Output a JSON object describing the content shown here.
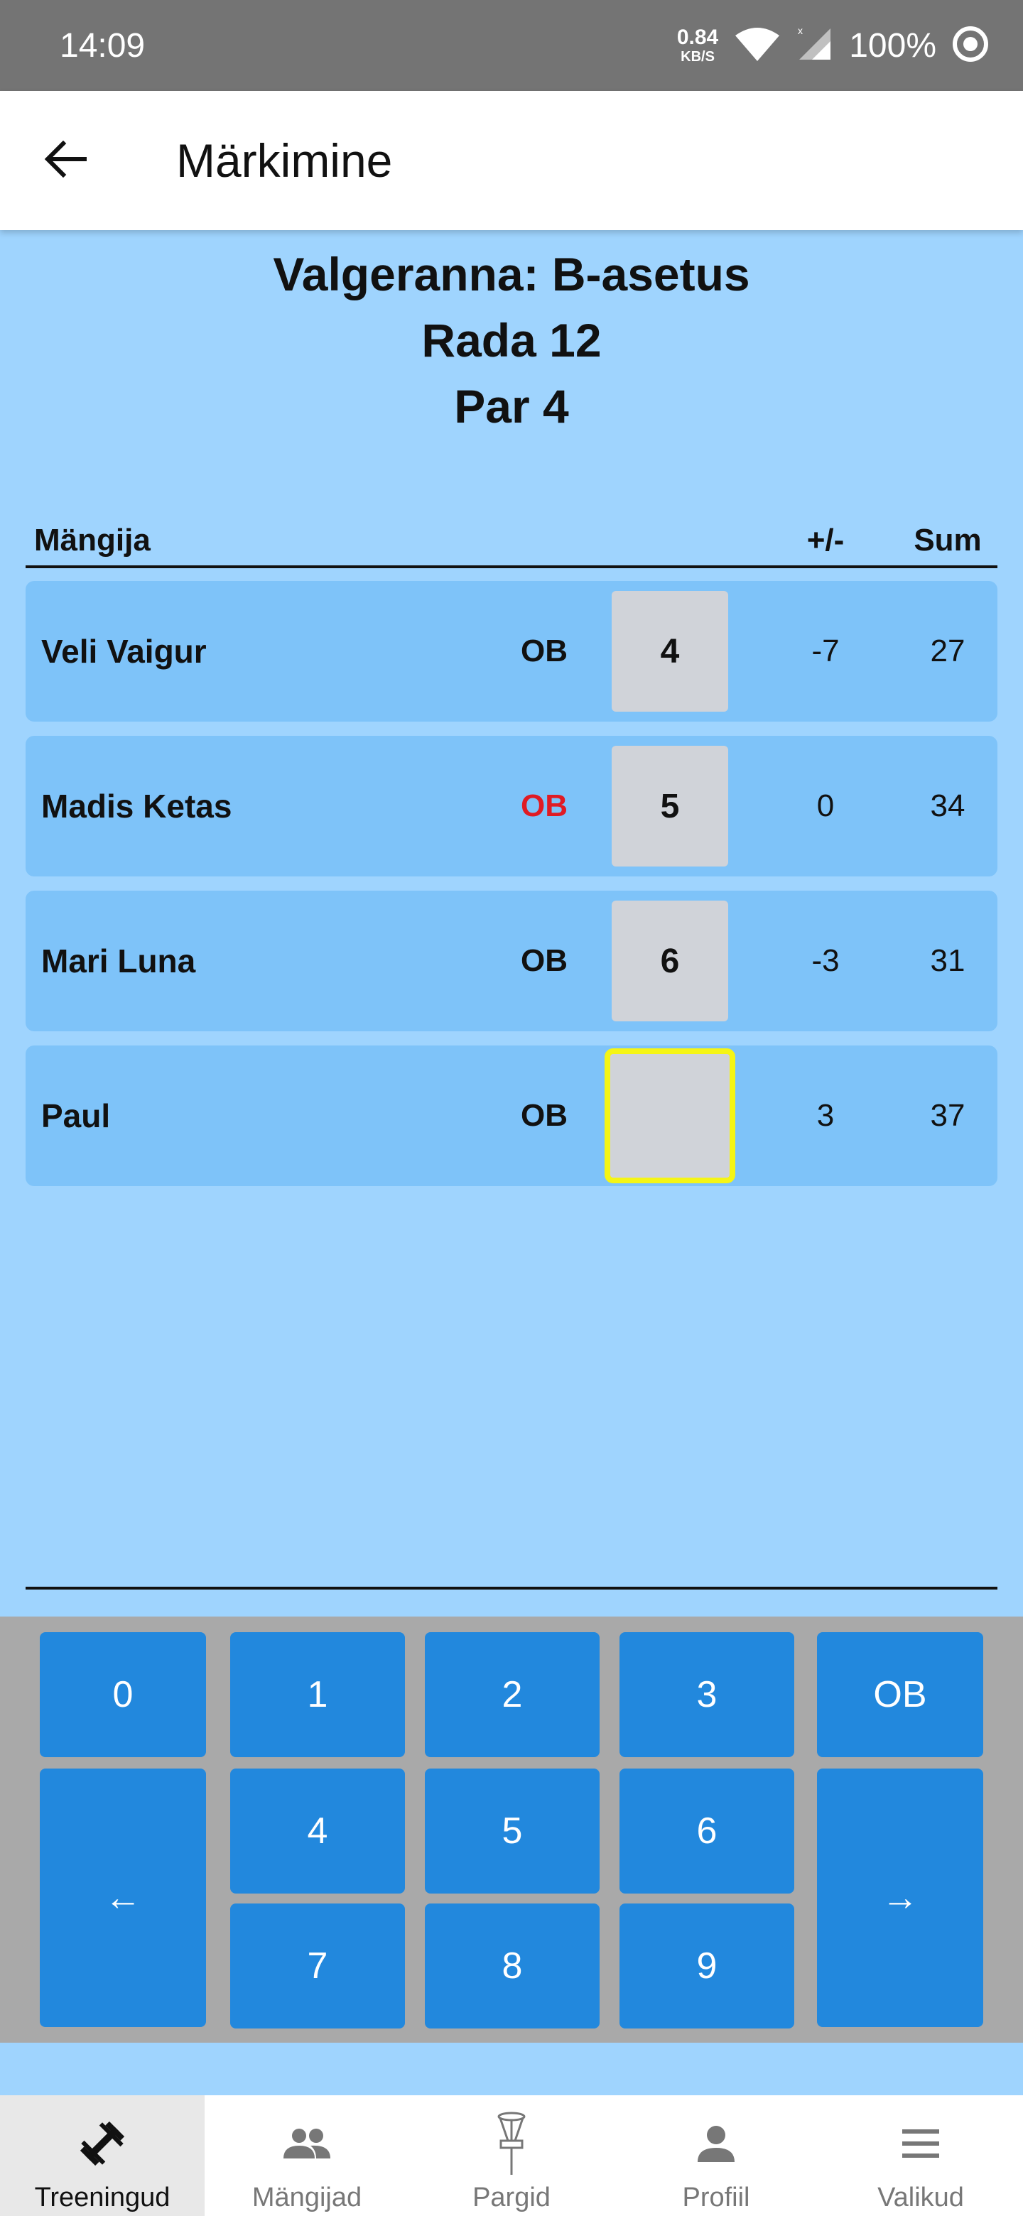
{
  "status_bar": {
    "time": "14:09",
    "net_speed_value": "0.84",
    "net_speed_unit": "KB/S",
    "battery": "100%"
  },
  "app_bar": {
    "title": "Märkimine",
    "back_icon": "arrow-left-icon"
  },
  "hole": {
    "course": "Valgeranna: B-asetus",
    "hole": "Rada 12",
    "par": "Par 4"
  },
  "table": {
    "header_player": "Mängija",
    "header_plus_minus": "+/-",
    "header_sum": "Sum",
    "rows": [
      {
        "name": "Veli Vaigur",
        "ob": "OB",
        "ob_active": false,
        "score": "4",
        "plus_minus": "-7",
        "sum": "27",
        "selected": false
      },
      {
        "name": "Madis Ketas",
        "ob": "OB",
        "ob_active": true,
        "score": "5",
        "plus_minus": "0",
        "sum": "34",
        "selected": false
      },
      {
        "name": "Mari Luna",
        "ob": "OB",
        "ob_active": false,
        "score": "6",
        "plus_minus": "-3",
        "sum": "31",
        "selected": false
      },
      {
        "name": "Paul",
        "ob": "OB",
        "ob_active": false,
        "score": "",
        "plus_minus": "3",
        "sum": "37",
        "selected": true
      }
    ]
  },
  "keypad": {
    "k0": "0",
    "k1": "1",
    "k2": "2",
    "k3": "3",
    "ob": "OB",
    "k4": "4",
    "k5": "5",
    "k6": "6",
    "k7": "7",
    "k8": "8",
    "k9": "9",
    "prev": "←",
    "next": "→"
  },
  "bottom_nav": {
    "items": [
      {
        "label": "Treeningud",
        "icon": "dumbbell-icon",
        "active": true
      },
      {
        "label": "Mängijad",
        "icon": "people-icon",
        "active": false
      },
      {
        "label": "Pargid",
        "icon": "disc-golf-basket-icon",
        "active": false
      },
      {
        "label": "Profiil",
        "icon": "person-icon",
        "active": false
      },
      {
        "label": "Valikud",
        "icon": "menu-icon",
        "active": false
      }
    ]
  },
  "colors": {
    "background": "#9fd4fe",
    "row": "#7ec3f9",
    "key": "#2288dd",
    "ob_active": "#e01b24",
    "selected_border": "#f5f515"
  }
}
